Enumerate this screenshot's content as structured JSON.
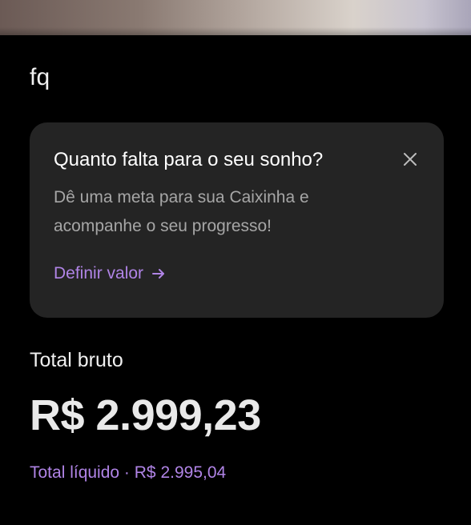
{
  "cover": {
    "image": "piggy-bank-cover-photo"
  },
  "box": {
    "name": "fq"
  },
  "goal_card": {
    "title": "Quanto falta para o seu sonho?",
    "description_line1": "Dê uma meta para sua Caixinha e",
    "description_line2": "acompanhe o seu progresso!",
    "action_label": "Definir valor",
    "action_icon": "arrow-right-icon",
    "close_icon": "close-icon"
  },
  "totals": {
    "gross_label": "Total bruto",
    "gross_value": "R$ 2.999,23",
    "net_label": "Total líquido",
    "separator": "·",
    "net_value": "R$ 2.995,04"
  },
  "colors": {
    "background": "#000000",
    "card": "#242424",
    "accent": "#B084E6",
    "text_primary": "#FFFFFF",
    "text_secondary": "#A6A6A6"
  }
}
